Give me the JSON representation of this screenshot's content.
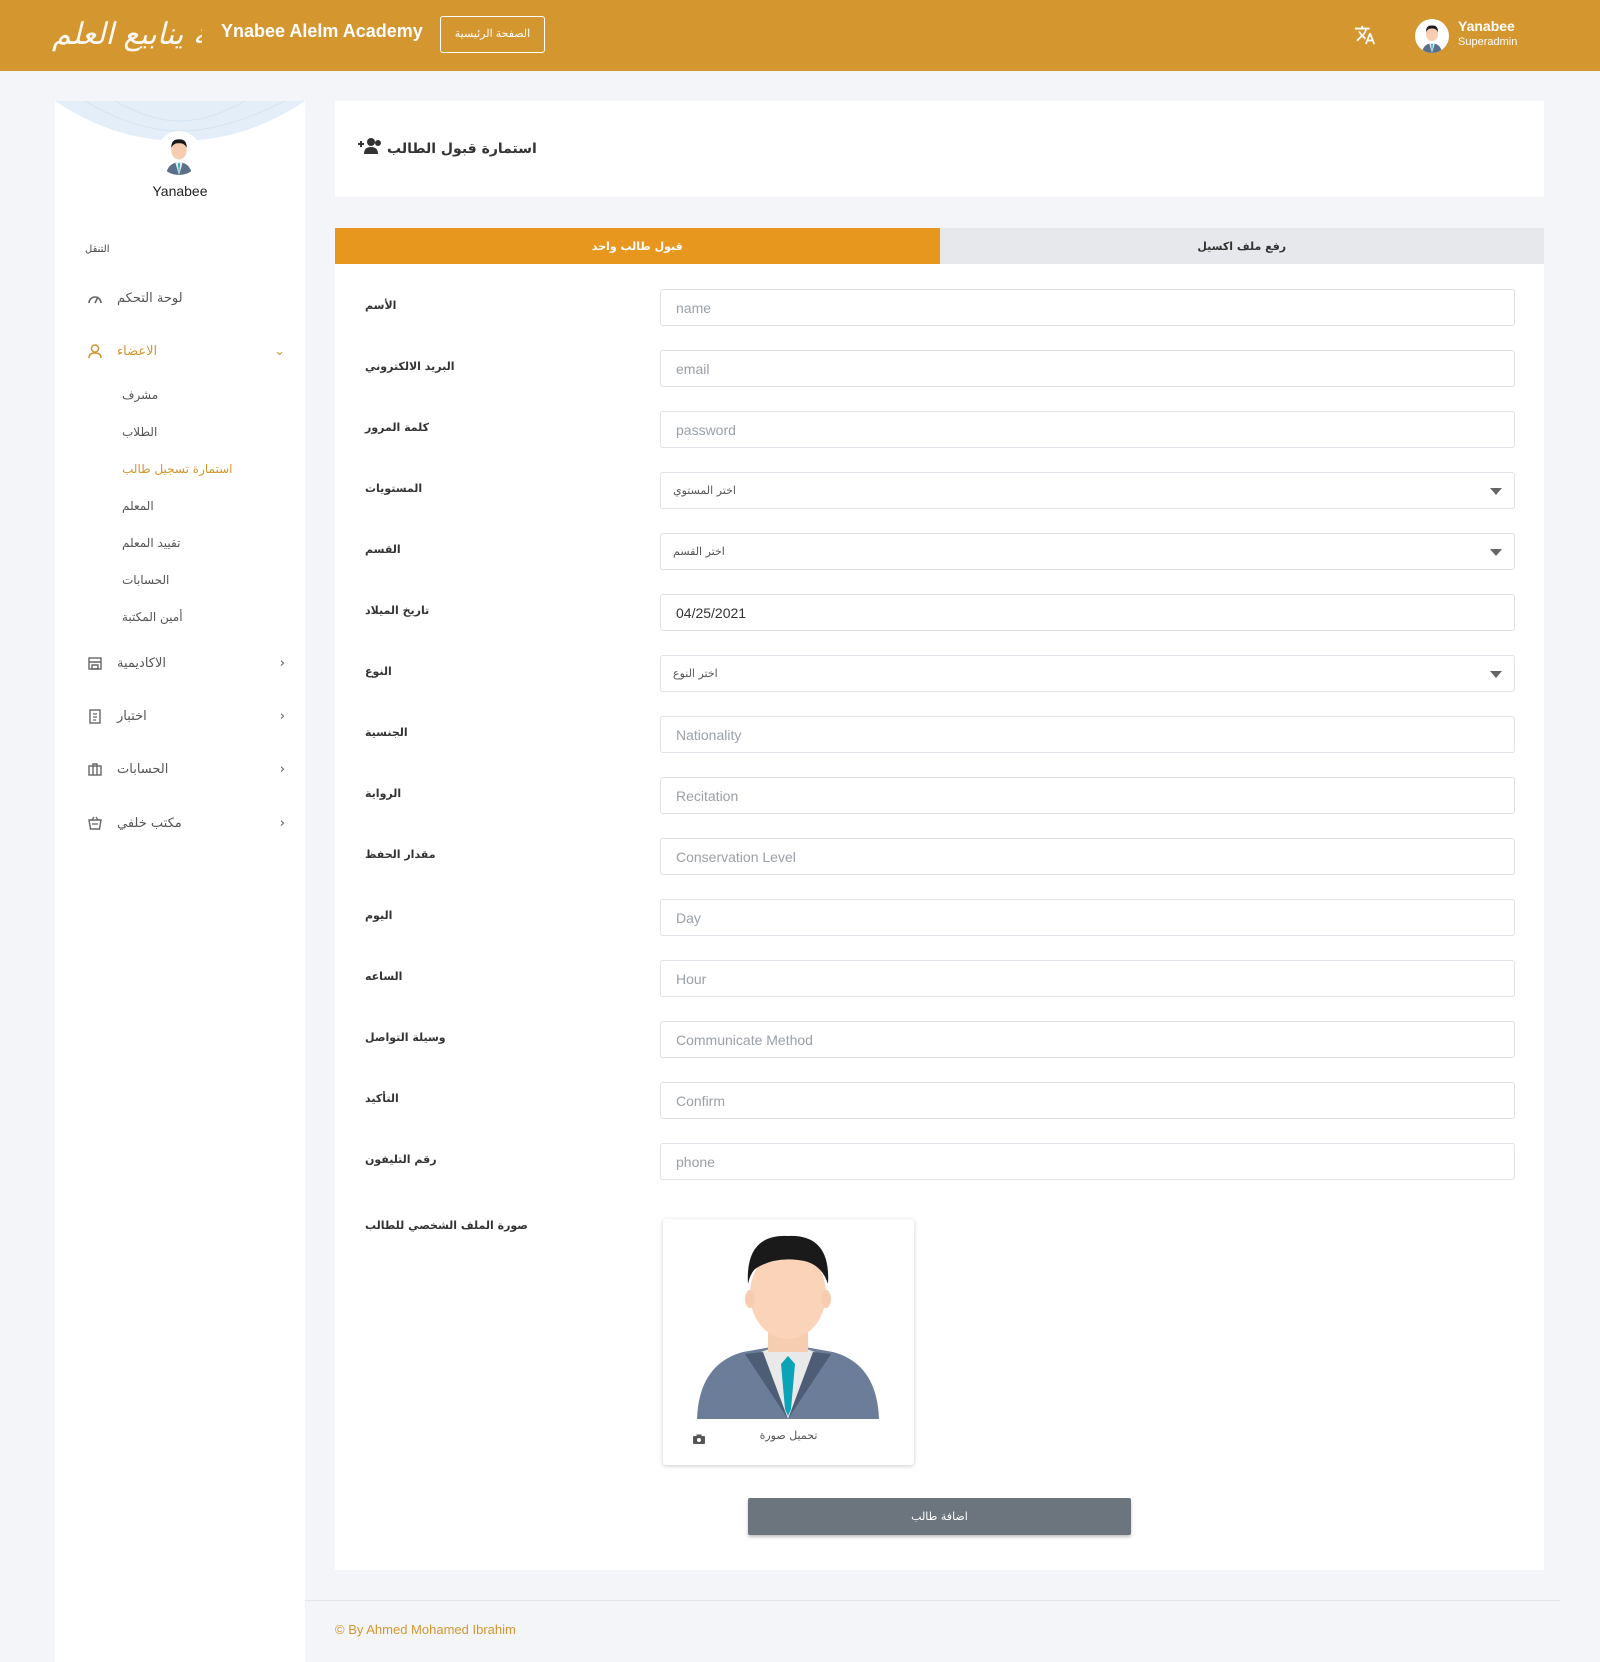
{
  "topbar": {
    "logo_text": "أكاديمية ينابيع العلم",
    "brand": "Ynabee Alelm Academy",
    "home_button": "الصفحة الرئيسية",
    "user_name": "Yanabee",
    "user_role": "Superadmin",
    "language_icon": "translate-icon"
  },
  "sidebar": {
    "user_name": "Yanabee",
    "nav_heading": "التنقل",
    "items": [
      {
        "label": "لوحة التحكم",
        "icon": "speedometer-icon"
      },
      {
        "label": "الاعضاء",
        "icon": "user-icon",
        "expanded": true
      },
      {
        "label": "الاكاديمية",
        "icon": "store-icon"
      },
      {
        "label": "اختبار",
        "icon": "clipboard-icon"
      },
      {
        "label": "الحسابات",
        "icon": "briefcase-icon"
      },
      {
        "label": "مكتب خلفي",
        "icon": "basket-icon"
      }
    ],
    "subitems": [
      "مشرف",
      "الطلاب",
      "استمارة تسجيل طالب",
      "المعلم",
      "تقييد المعلم",
      "الحسابات",
      "أمين المكتبة"
    ],
    "active_subitem": "استمارة تسجيل طالب"
  },
  "page": {
    "title": "استمارة قبول الطالب"
  },
  "tabs": {
    "single": "قبول طالب واحد",
    "excel": "رفع ملف اكسيل"
  },
  "form": {
    "fields": [
      {
        "label": "الأسم",
        "placeholder": "name",
        "value": ""
      },
      {
        "label": "البريد الالكتروني",
        "placeholder": "email",
        "value": ""
      },
      {
        "label": "كلمة المرور",
        "placeholder": "password",
        "value": ""
      },
      {
        "label": "المستويات",
        "select": "اختر المستوي"
      },
      {
        "label": "القسم",
        "select": "اختر القسم"
      },
      {
        "label": "تاريخ الميلاد",
        "placeholder": "",
        "value": "04/25/2021"
      },
      {
        "label": "النوع",
        "select": "اختر النوع"
      },
      {
        "label": "الجنسية",
        "placeholder": "Nationality",
        "value": ""
      },
      {
        "label": "الرواية",
        "placeholder": "Recitation",
        "value": ""
      },
      {
        "label": "مقدار الحفظ",
        "placeholder": "Conservation Level",
        "value": ""
      },
      {
        "label": "اليوم",
        "placeholder": "Day",
        "value": ""
      },
      {
        "label": "الساعه",
        "placeholder": "Hour",
        "value": ""
      },
      {
        "label": "وسيلة التواصل",
        "placeholder": "Communicate Method",
        "value": ""
      },
      {
        "label": "التأكيد",
        "placeholder": "Confirm",
        "value": ""
      },
      {
        "label": "رقم التليفون",
        "placeholder": "phone",
        "value": ""
      }
    ],
    "photo_label": "صورة الملف الشخصي للطالب",
    "upload_label": "تحميل صورة",
    "submit_label": "اضافة طالب"
  },
  "footer": {
    "text": "© By Ahmed Mohamed Ibrahim"
  },
  "colors": {
    "brand": "#d4962e",
    "active_tab": "#e8971e",
    "submit": "#6c757d"
  }
}
